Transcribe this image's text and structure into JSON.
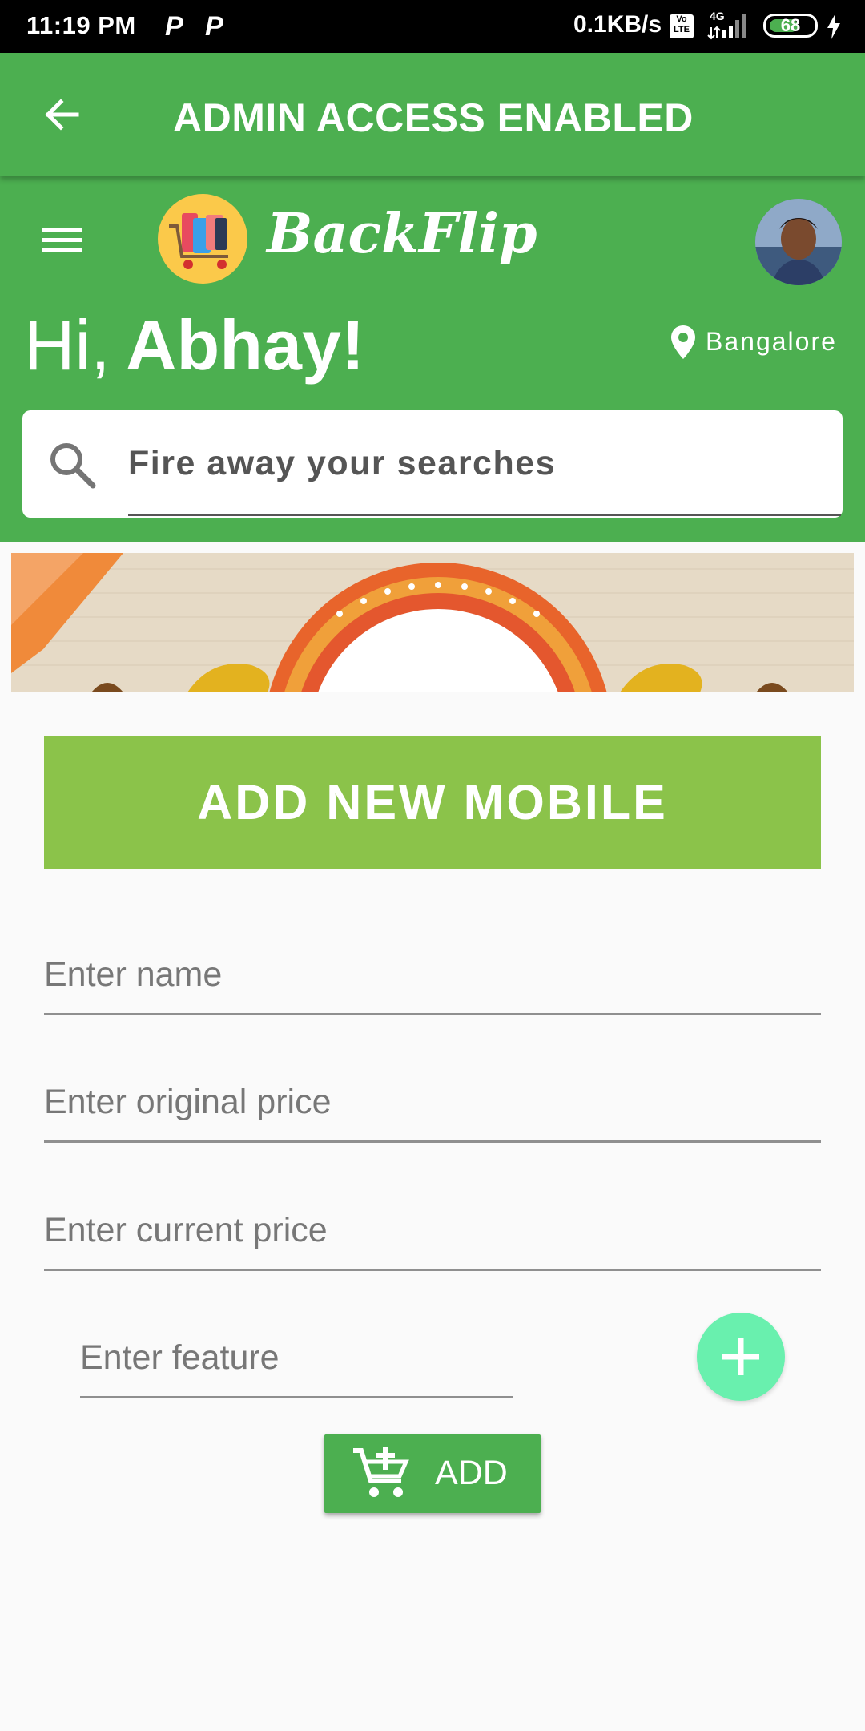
{
  "status_bar": {
    "time": "11:19 PM",
    "notif_icons": [
      "P",
      "P"
    ],
    "net_speed": "0.1KB/s",
    "volte": "Vo LTE",
    "network": "4G",
    "battery": "68",
    "battery_level_pct": 68
  },
  "admin_bar": {
    "title": "ADMIN ACCESS ENABLED",
    "back_icon": "arrow-back-icon"
  },
  "header": {
    "brand": "BackFlip",
    "greeting_hi": "Hi,",
    "greeting_name": "Abhay!",
    "location": "Bangalore"
  },
  "search": {
    "placeholder": "Fire away your searches"
  },
  "form": {
    "title": "ADD NEW MOBILE",
    "name_placeholder": "Enter name",
    "original_price_placeholder": "Enter original price",
    "current_price_placeholder": "Enter current price",
    "feature_placeholder": "Enter feature",
    "add_label": "ADD"
  },
  "colors": {
    "primary": "#4caf50",
    "accent_light_green": "#8bc34a",
    "fab": "#69f0ae"
  }
}
